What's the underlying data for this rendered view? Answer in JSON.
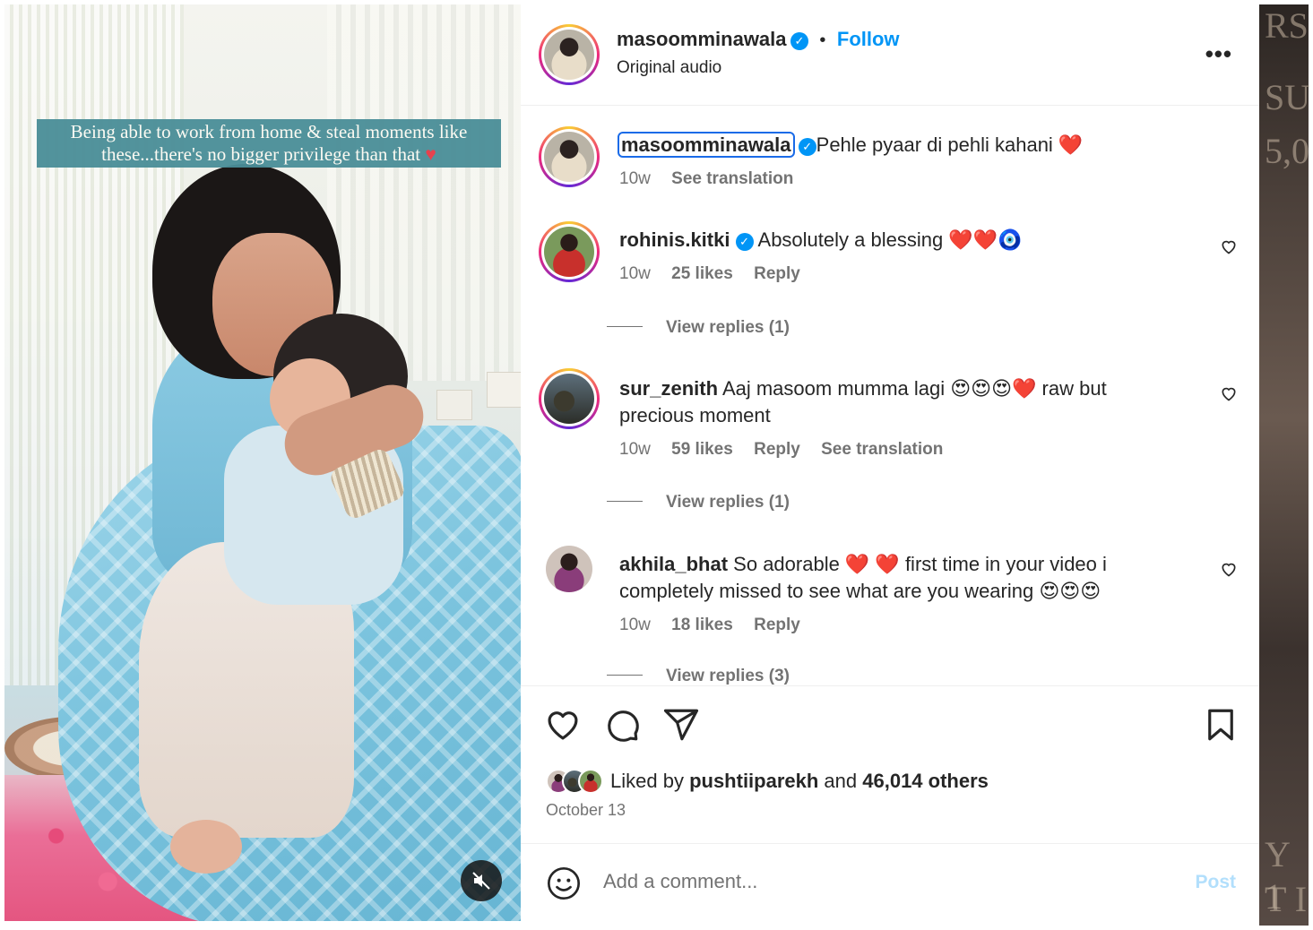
{
  "media": {
    "overlay_text_line1": "Being able to work from home & steal moments like",
    "overlay_text_line2": "these...there's no bigger privilege than that",
    "overlay_emoji": "♥"
  },
  "header": {
    "username": "masoomminawala",
    "separator": "•",
    "follow_label": "Follow",
    "subtitle": "Original audio",
    "more_label": "•••"
  },
  "caption": {
    "username": "masoomminawala",
    "text": "Pehle pyaar di pehli kahani ❤️",
    "time": "10w",
    "see_translation": "See translation"
  },
  "comments": [
    {
      "username": "rohinis.kitki",
      "verified": true,
      "text": "Absolutely a blessing ❤️❤️🧿",
      "time": "10w",
      "likes": "25 likes",
      "reply": "Reply",
      "view_replies": "View replies (1)"
    },
    {
      "username": "sur_zenith",
      "verified": false,
      "text": "Aaj masoom mumma lagi 😍😍😍❤️ raw but precious moment",
      "time": "10w",
      "likes": "59 likes",
      "reply": "Reply",
      "see_translation": "See translation",
      "view_replies": "View replies (1)"
    },
    {
      "username": "akhila_bhat",
      "verified": false,
      "text": "So adorable ❤️ ❤️ first time in your video i completely missed to see what are you wearing 😍😍😍",
      "time": "10w",
      "likes": "18 likes",
      "reply": "Reply",
      "view_replies": "View replies (3)"
    }
  ],
  "likes": {
    "prefix": "Liked by ",
    "user": "pushtiiparekh",
    "middle": " and ",
    "others": "46,014 others",
    "date": "October 13"
  },
  "add_comment": {
    "placeholder": "Add a comment...",
    "post_label": "Post"
  },
  "colors": {
    "accent": "#0095f6",
    "secondary_text": "#737373",
    "primary_text": "#262626",
    "post_disabled": "#b2dffc"
  },
  "icons": {
    "verified": "verified-badge-icon",
    "like": "heart-icon",
    "comment": "comment-bubble-icon",
    "share": "send-icon",
    "save": "bookmark-icon",
    "emoji": "smiley-icon",
    "mute": "speaker-muted-icon"
  }
}
